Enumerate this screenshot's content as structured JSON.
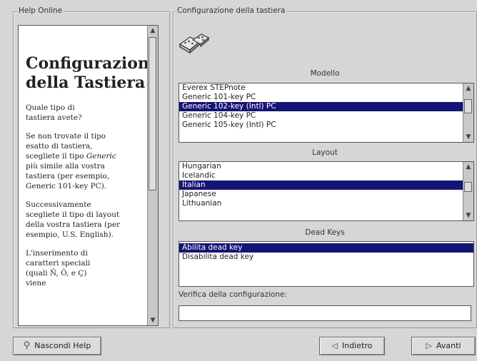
{
  "help": {
    "group_title": "Help Online",
    "heading": "Configurazione della Tastiera",
    "paragraphs": [
      "Quale tipo di tastiera avete?",
      "Se non trovate il tipo esatto di tastiera, scegliete il tipo Generic più simile alla vostra tastiera (per esempio, Generic 101-key PC).",
      "Successivamente scegliete il tipo di layout della vostra tastiera (per esempio, U.S. English).",
      "L'inserimento di caratteri speciali (quali Ñ, Ô, e Ç) viene"
    ]
  },
  "config": {
    "group_title": "Configurazione della tastiera",
    "model_label": "Modello",
    "model_items": [
      "Everex STEPnote",
      "Generic 101-key PC",
      "Generic 102-key (Intl) PC",
      "Generic 104-key PC",
      "Generic 105-key (Intl) PC"
    ],
    "model_selected": "Generic 102-key (Intl) PC",
    "layout_label": "Layout",
    "layout_items": [
      "Hungarian",
      "Icelandic",
      "Italian",
      "Japanese",
      "Lithuanian"
    ],
    "layout_selected": "Italian",
    "deadkeys_label": "Dead Keys",
    "deadkeys_items": [
      "Abilita dead key",
      "Disabilita dead key"
    ],
    "deadkeys_selected": "Abilita dead key",
    "verify_label": "Verifica della configurazione:",
    "verify_value": ""
  },
  "buttons": {
    "hide_help": "Nascondi Help",
    "back": "Indietro",
    "next": "Avanti"
  },
  "icons": {
    "keyboard": "keyboard-icon",
    "help": "help-icon",
    "back": "back-arrow-icon",
    "next": "next-arrow-icon"
  }
}
